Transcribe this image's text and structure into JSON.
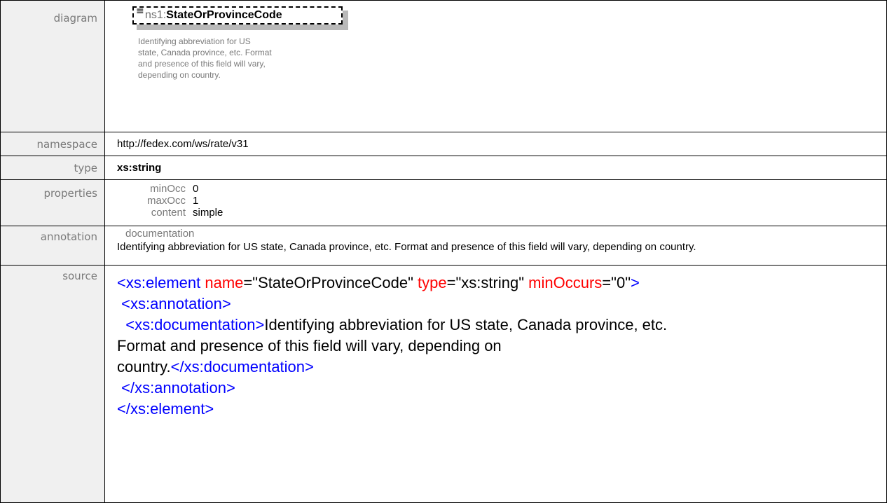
{
  "labels": {
    "diagram": "diagram",
    "namespace": "namespace",
    "type": "type",
    "properties": "properties",
    "annotation": "annotation",
    "source": "source"
  },
  "diagram": {
    "menu_icon": "≡",
    "prefix": "ns1:",
    "name": "StateOrProvinceCode",
    "doc_lines": [
      "Identifying abbreviation for US",
      "state, Canada province, etc. Format",
      "and presence of this field will vary,",
      "depending on country."
    ]
  },
  "namespace": "http://fedex.com/ws/rate/v31",
  "type": "xs:string",
  "properties": {
    "items": [
      {
        "key": "minOcc",
        "value": "0"
      },
      {
        "key": "maxOcc",
        "value": "1"
      },
      {
        "key": "content",
        "value": "simple"
      }
    ]
  },
  "annotation": {
    "heading": "documentation",
    "text": "Identifying abbreviation for US state, Canada province, etc. Format and presence of this field will vary, depending on country."
  },
  "source": {
    "l1_open": "<",
    "l1_tag": "xs:element",
    "l1_attr1": "name",
    "l1_eq1": "=\"",
    "l1_val1": "StateOrProvinceCode",
    "l1_q1": "\"",
    "l1_attr2": "type",
    "l1_eq2": "=\"",
    "l1_val2": "xs:string",
    "l1_q2": "\"",
    "l1_attr3": "minOccurs",
    "l1_eq3": "=\"",
    "l1_val3": "0",
    "l1_q3": "\"",
    "l1_close": ">",
    "l2": " <xs:annotation>",
    "l3_tag": "  <xs:documentation>",
    "l3_text": "Identifying abbreviation for US state, Canada province, etc.",
    "l4_text": "Format and presence of this field will vary, depending on",
    "l5_text": "country.",
    "l5_tag": "</xs:documentation>",
    "l6": " </xs:annotation>",
    "l7": "</xs:element>"
  }
}
